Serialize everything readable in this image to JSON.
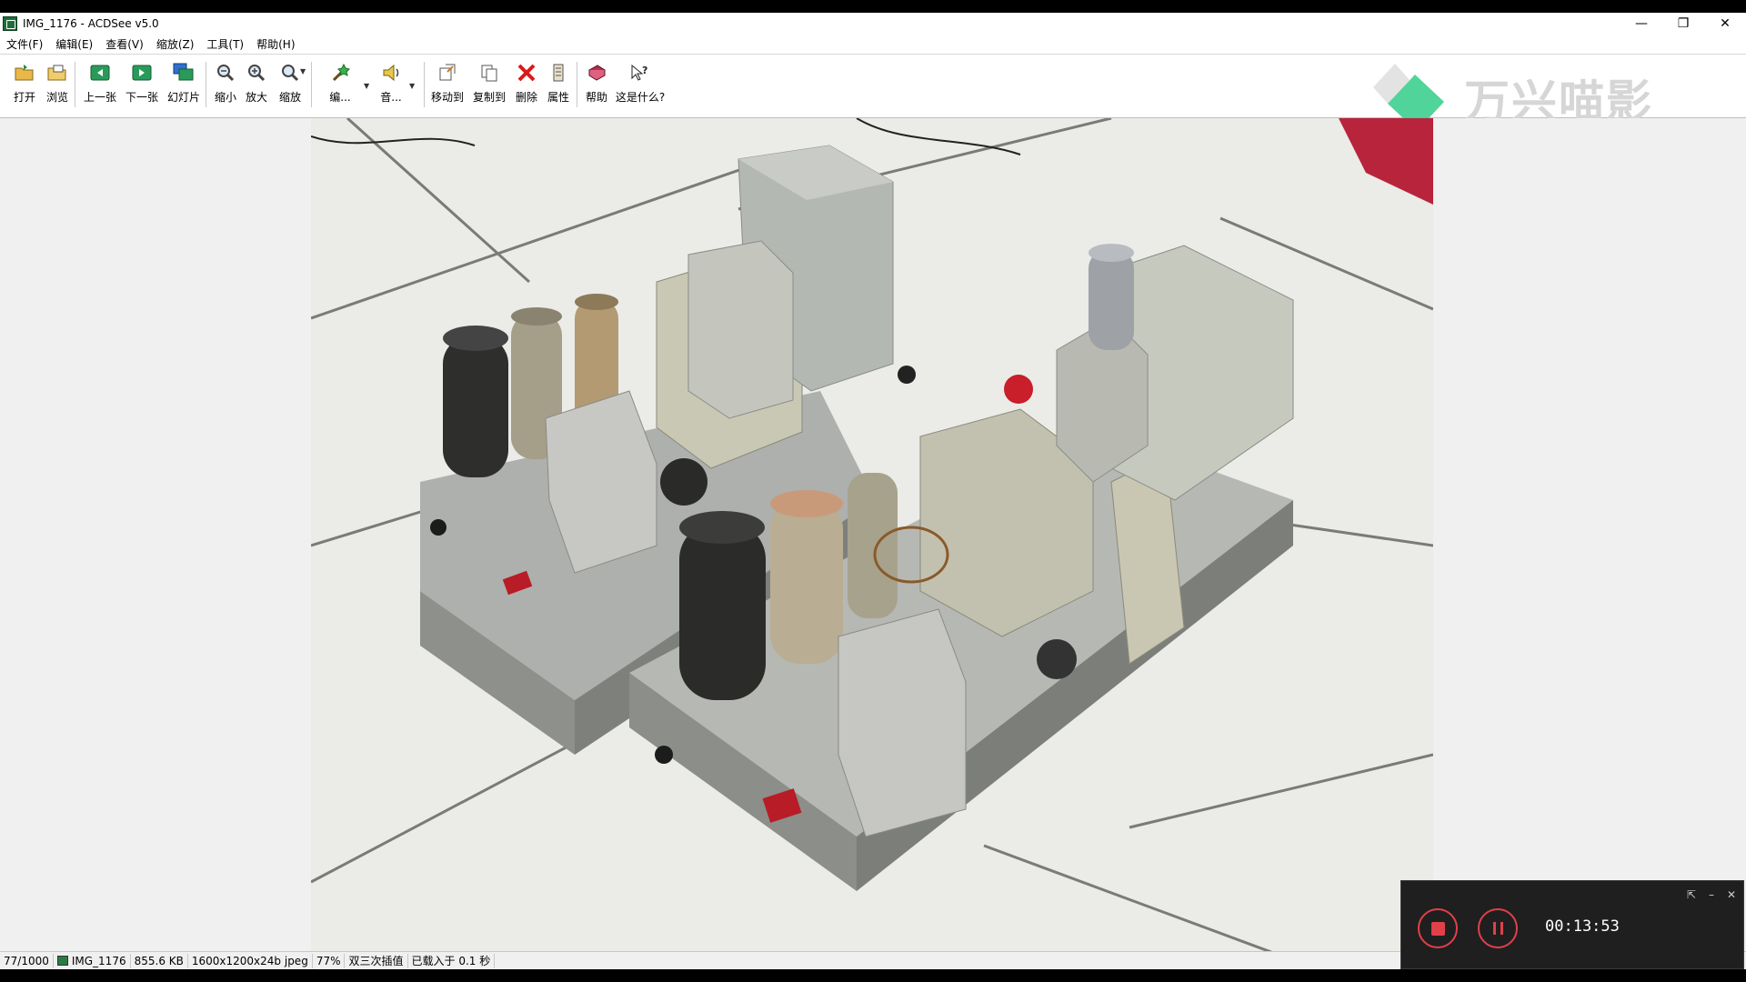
{
  "window": {
    "title": "IMG_1176 - ACDSee v5.0",
    "controls": {
      "minimize": "—",
      "restore": "❐",
      "close": "✕"
    }
  },
  "menu": [
    "文件(F)",
    "编辑(E)",
    "查看(V)",
    "缩放(Z)",
    "工具(T)",
    "帮助(H)"
  ],
  "toolbar": {
    "open": "打开",
    "browse": "浏览",
    "prev": "上一张",
    "next": "下一张",
    "slideshow": "幻灯片",
    "zoom_out": "缩小",
    "zoom_in": "放大",
    "zoom": "缩放",
    "edit": "编...",
    "audio": "音...",
    "move_to": "移动到",
    "copy_to": "复制到",
    "delete": "删除",
    "properties": "属性",
    "help": "帮助",
    "whats_this": "这是什么?"
  },
  "watermark": {
    "text": "万兴喵影"
  },
  "status": {
    "index": "77/1000",
    "filename": "IMG_1176",
    "size": "855.6 KB",
    "dimensions": "1600x1200x24b jpeg",
    "zoom": "77%",
    "resample": "双三次插值",
    "load_time": "已载入于 0.1 秒"
  },
  "recorder": {
    "time": "00:13:53"
  },
  "colors": {
    "accent_red": "#e0404a",
    "watermark_green": "#3ecf8e",
    "toolbar_bg": "#ffffff"
  }
}
